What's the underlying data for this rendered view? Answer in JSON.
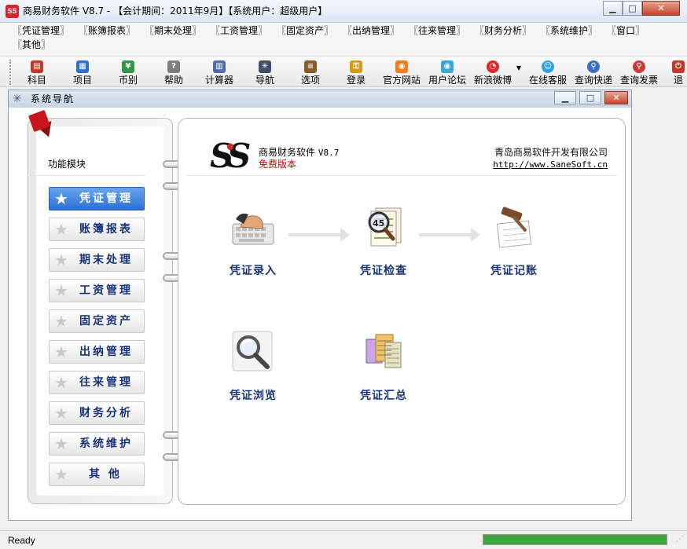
{
  "titlebar": {
    "title": "商易财务软件 V8.7 - 【会计期间：2011年9月】【系统用户：超级用户】",
    "app_icon": "SS"
  },
  "menu": [
    "〖凭证管理〗",
    "〖账簿报表〗",
    "〖期末处理〗",
    "〖工资管理〗",
    "〖固定资产〗",
    "〖出纳管理〗",
    "〖往来管理〗",
    "〖财务分析〗",
    "〖系统维护〗",
    "〖窗口〗",
    "〖其他〗"
  ],
  "toolbar": [
    {
      "label": "科目",
      "icon": "chart-of-accounts-icon",
      "color": "#c0392b"
    },
    {
      "label": "项目",
      "icon": "project-icon",
      "color": "#2e6fcf"
    },
    {
      "label": "币别",
      "icon": "currency-icon",
      "color": "#2e9a45"
    },
    {
      "label": "帮助",
      "icon": "help-icon",
      "color": "#7d7d7d"
    },
    {
      "label": "计算器",
      "icon": "calculator-icon",
      "color": "#4f6ea8"
    },
    {
      "label": "导航",
      "icon": "navigation-icon",
      "color": "#3f4f66"
    },
    {
      "label": "选项",
      "icon": "options-icon",
      "color": "#8a5a2b"
    },
    {
      "label": "登录",
      "icon": "login-key-icon",
      "color": "#d49a12"
    },
    {
      "label": "官方网站",
      "icon": "rss-website-icon",
      "color": "#f07d19"
    },
    {
      "label": "用户论坛",
      "icon": "rss-forum-icon",
      "color": "#3aa7d8"
    },
    {
      "label": "新浪微博",
      "icon": "weibo-icon",
      "color": "#e0262b"
    },
    {
      "label": "在线客服",
      "icon": "online-service-icon",
      "color": "#2fa0e0"
    },
    {
      "label": "查询快递",
      "icon": "search-express-icon",
      "color": "#3a6fc4"
    },
    {
      "label": "查询发票",
      "icon": "search-invoice-icon",
      "color": "#c83a3a"
    },
    {
      "label": "退",
      "icon": "exit-icon",
      "color": "#c0392b"
    }
  ],
  "nav_window": {
    "title": "系统导航"
  },
  "left_panel": {
    "section_label": "功能模块",
    "active_index": 0,
    "buttons": [
      "凭证管理",
      "账簿报表",
      "期末处理",
      "工资管理",
      "固定资产",
      "出纳管理",
      "往来管理",
      "财务分析",
      "系统维护",
      "其 他"
    ]
  },
  "header": {
    "logo_text": "SS",
    "product": "商易财务软件",
    "version": "V8.7",
    "edition": "免费版本",
    "company": "青岛商易软件开发有限公司",
    "website": "http://www.SaneSoft.cn"
  },
  "functions": [
    {
      "label": "凭证录入",
      "icon": "keyboard-typing-icon"
    },
    {
      "label": "凭证检查",
      "icon": "magnifier-check-icon"
    },
    {
      "label": "凭证记账",
      "icon": "gavel-posting-icon"
    },
    {
      "label": "凭证浏览",
      "icon": "magnifying-glass-icon"
    },
    {
      "label": "凭证汇总",
      "icon": "summary-documents-icon"
    }
  ],
  "statusbar": {
    "text": "Ready",
    "progress": 1.0
  },
  "colors": {
    "accent": "#2c6fd4",
    "nav_text": "#17347a",
    "brand_red": "#c00000"
  }
}
